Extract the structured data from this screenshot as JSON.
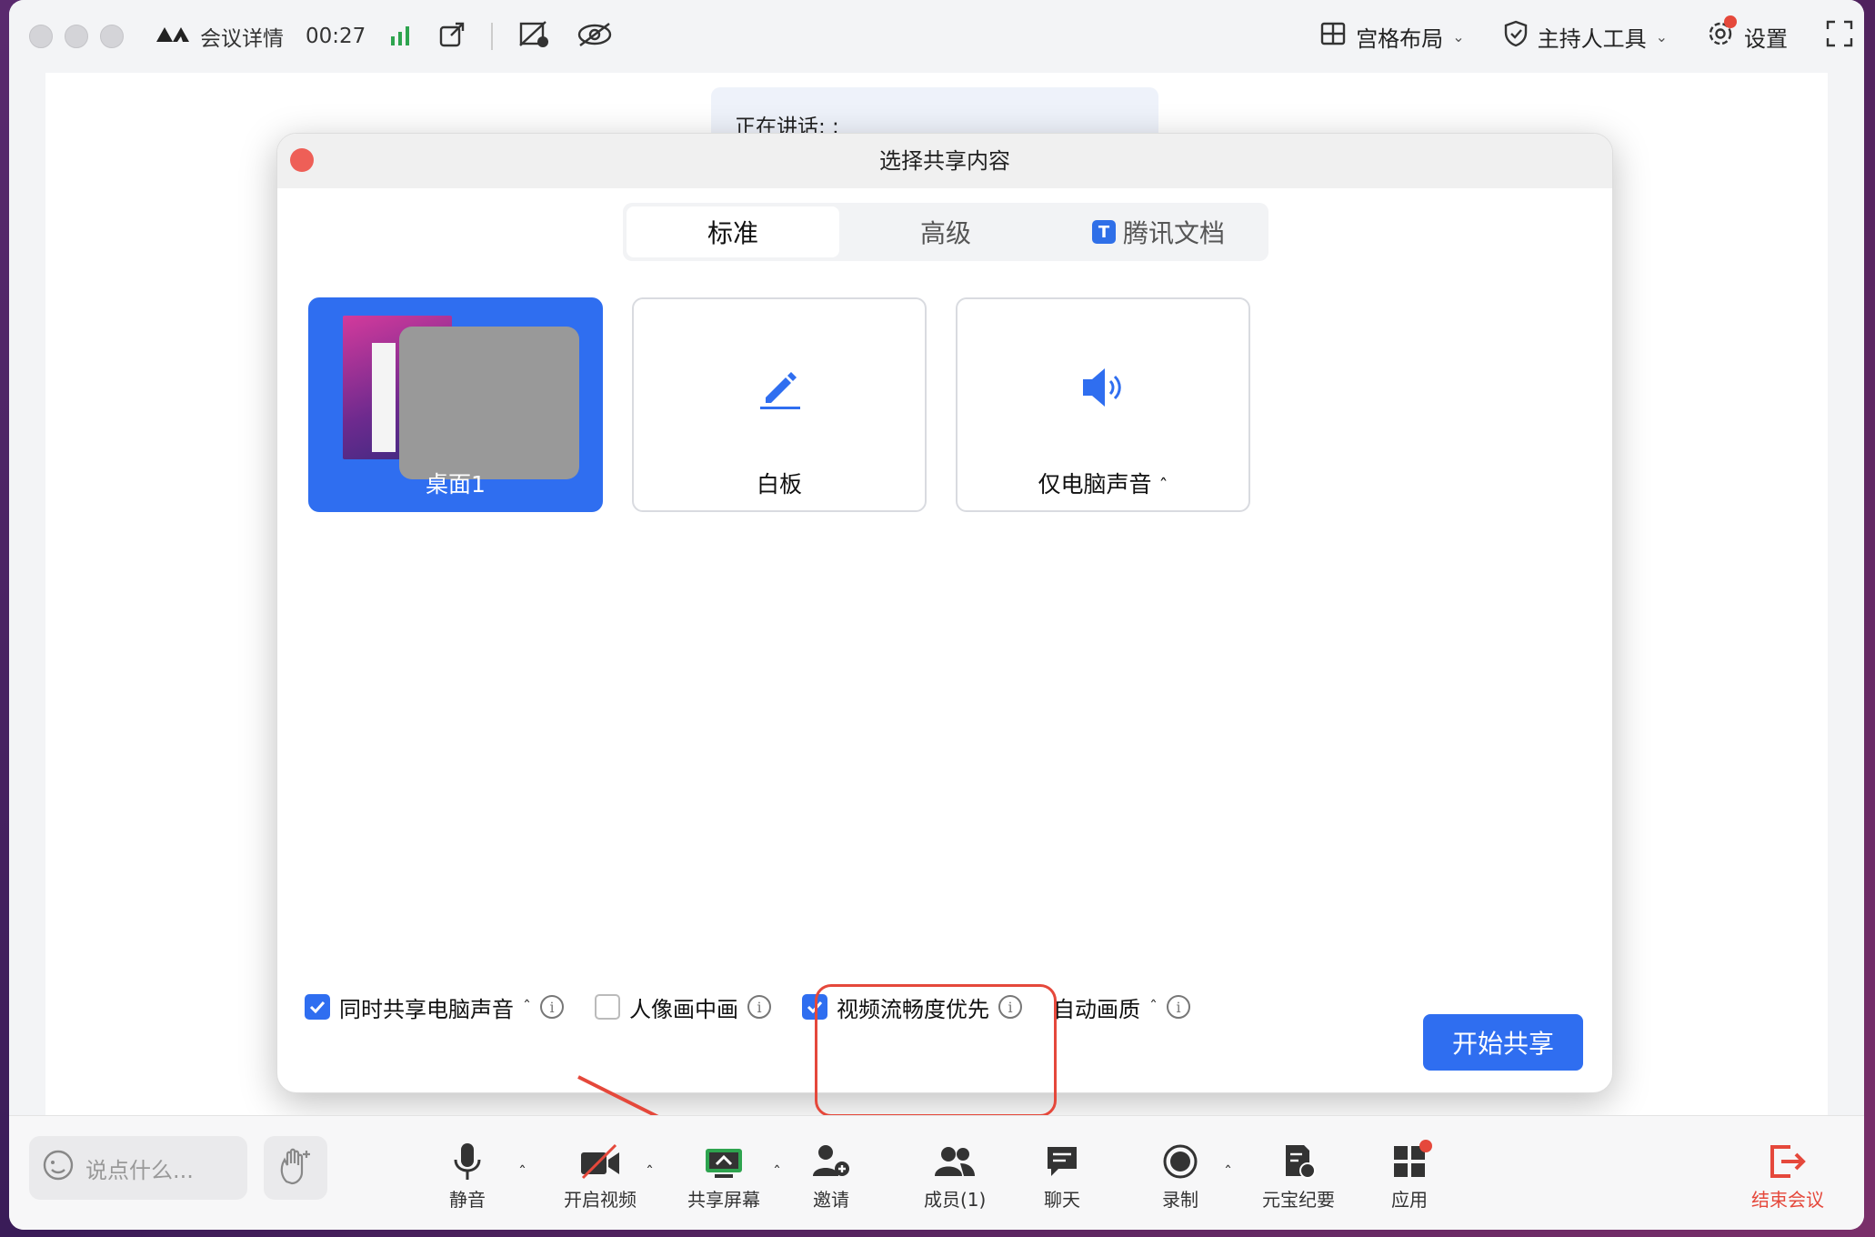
{
  "titlebar": {
    "meeting_details": "会议详情",
    "timer": "00:27",
    "layout_label": "宫格布局",
    "host_tools_label": "主持人工具",
    "settings_label": "设置"
  },
  "speaking_banner": "正在讲话: ;",
  "dialog": {
    "title": "选择共享内容",
    "tabs": [
      {
        "label": "标准"
      },
      {
        "label": "高级"
      },
      {
        "label": "腾讯文档"
      }
    ],
    "cards": [
      {
        "label": "桌面1"
      },
      {
        "label": "白板"
      },
      {
        "label": "仅电脑声音"
      }
    ],
    "options": {
      "share_audio": "同时共享电脑声音",
      "pip": "人像画中画",
      "video_priority": "视频流畅度优先",
      "quality": "自动画质"
    },
    "start_button": "开始共享"
  },
  "toolbar": {
    "chat_placeholder": "说点什么...",
    "mute": "静音",
    "video": "开启视频",
    "share": "共享屏幕",
    "invite": "邀请",
    "members": "成员(1)",
    "chat": "聊天",
    "record": "录制",
    "summary": "元宝纪要",
    "apps": "应用",
    "end": "结束会议"
  },
  "colors": {
    "accent": "#2f6ef0",
    "danger": "#e5483b",
    "signal": "#2ea44f"
  }
}
